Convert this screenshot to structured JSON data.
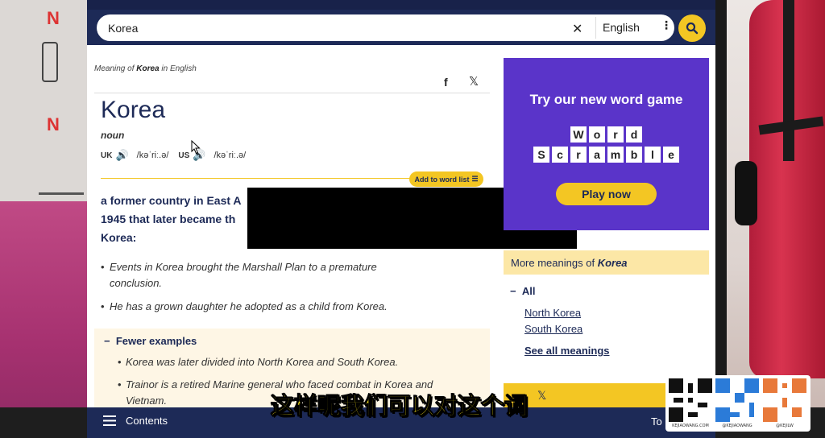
{
  "search": {
    "value": "Korea",
    "language": "English"
  },
  "entry": {
    "meaning_prefix": "Meaning of",
    "meaning_word": "Korea",
    "meaning_suffix": "in English",
    "headword": "Korea",
    "part_of_speech": "noun",
    "uk_label": "UK",
    "uk_ipa": "/kəˈriː.ə/",
    "us_label": "US",
    "us_ipa": "/kəˈriː.ə/",
    "add_to_word_list": "Add to word list",
    "definition_line1": "a former country in East A",
    "definition_line2": "1945 that later became th",
    "definition_line3": "Korea:",
    "examples": [
      "Events in Korea brought the Marshall Plan to a premature conclusion.",
      "He has a grown daughter he adopted as a child from Korea."
    ],
    "fewer_examples_label": "Fewer examples",
    "fewer_examples": [
      "Korea was later divided into North Korea and South Korea.",
      "Trainor is a retired Marine general who faced combat in Korea and Vietnam."
    ]
  },
  "ad": {
    "title": "Try our new word game",
    "word1": [
      "W",
      "o",
      "r",
      "d"
    ],
    "word2": [
      "S",
      "c",
      "r",
      "a",
      "m",
      "b",
      "l",
      "e"
    ],
    "cta": "Play now"
  },
  "more_meanings": {
    "prefix": "More meanings of",
    "word": "Korea",
    "all_label": "All",
    "links": [
      "North Korea",
      "South Korea"
    ],
    "see_all": "See all meanings"
  },
  "bottom_bar": {
    "contents_label": "Contents",
    "to_label": "To"
  },
  "overlay": {
    "subtitle": "这样呢我们可以对这个词",
    "qr_captions": [
      "KEJIAOWANG.COM",
      "@KEJIAOWANG",
      "@KEJILW"
    ]
  },
  "colors": {
    "navy": "#1d2a57",
    "accent_yellow": "#f3c623",
    "ad_purple": "#5a34c9"
  }
}
